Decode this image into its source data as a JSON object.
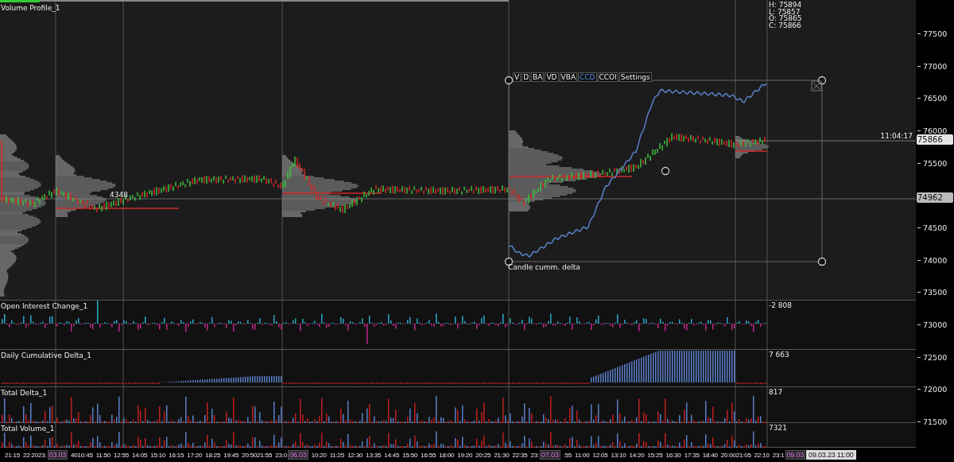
{
  "main": {
    "title": "Volume Profile_1",
    "ohlc": [
      "H: 75894",
      "L: 75857",
      "O: 75865",
      "C: 75866"
    ],
    "toolbar": [
      {
        "label": "V",
        "selected": false
      },
      {
        "label": "D",
        "selected": false
      },
      {
        "label": "BA",
        "selected": false
      },
      {
        "label": "VD",
        "selected": false
      },
      {
        "label": "VBA",
        "selected": false
      },
      {
        "label": "CCD",
        "selected": true
      },
      {
        "label": "CCOI",
        "selected": false
      },
      {
        "label": "Settings",
        "selected": false
      }
    ],
    "indicator_label": "Candle cumm. delta",
    "profile_label": "4348",
    "countdown": "11:04:17"
  },
  "subpanels": [
    {
      "kind": "oi",
      "title": "Open Interest Change_1",
      "value": "-2 808"
    },
    {
      "kind": "cumdelta",
      "title": "Daily Cumulative Delta_1",
      "value": "7 663"
    },
    {
      "kind": "delta",
      "title": "Total Delta_1",
      "value": "817"
    },
    {
      "kind": "volume",
      "title": "Total Volume_1",
      "value": "7321"
    }
  ],
  "price_axis": {
    "ticks": [
      "77500",
      "77000",
      "76500",
      "76000",
      "75500",
      "74500",
      "74000",
      "73500",
      "73000",
      "72500",
      "72000",
      "71500"
    ],
    "markers": [
      {
        "value": "75866",
        "kind": "last"
      },
      {
        "value": "74962",
        "kind": "cursor"
      }
    ]
  },
  "time_axis": [
    {
      "text": "21:15",
      "kind": "time"
    },
    {
      "text": "22:2023:",
      "kind": "time"
    },
    {
      "text": "03.03",
      "kind": "date"
    },
    {
      "text": "4010:45",
      "kind": "time"
    },
    {
      "text": "11:50",
      "kind": "time"
    },
    {
      "text": "12:55",
      "kind": "time"
    },
    {
      "text": "14:05",
      "kind": "time"
    },
    {
      "text": "15:10",
      "kind": "time"
    },
    {
      "text": "16:15",
      "kind": "time"
    },
    {
      "text": "17:20",
      "kind": "time"
    },
    {
      "text": "18:25",
      "kind": "time"
    },
    {
      "text": "19:45",
      "kind": "time"
    },
    {
      "text": "20:5021:55",
      "kind": "time"
    },
    {
      "text": "23:0",
      "kind": "time"
    },
    {
      "text": "06.03",
      "kind": "date"
    },
    {
      "text": "10:20",
      "kind": "time"
    },
    {
      "text": "11:25",
      "kind": "time"
    },
    {
      "text": "12:30",
      "kind": "time"
    },
    {
      "text": "13:35",
      "kind": "time"
    },
    {
      "text": "14:45",
      "kind": "time"
    },
    {
      "text": "15:50",
      "kind": "time"
    },
    {
      "text": "16:55",
      "kind": "time"
    },
    {
      "text": "18:00",
      "kind": "time"
    },
    {
      "text": "19:20",
      "kind": "time"
    },
    {
      "text": "20:25",
      "kind": "time"
    },
    {
      "text": "21:30",
      "kind": "time"
    },
    {
      "text": "22:35",
      "kind": "time"
    },
    {
      "text": "23:",
      "kind": "time"
    },
    {
      "text": "07.03",
      "kind": "date"
    },
    {
      "text": ":55",
      "kind": "time"
    },
    {
      "text": "11:00",
      "kind": "time"
    },
    {
      "text": "12:05",
      "kind": "time"
    },
    {
      "text": "13:10",
      "kind": "time"
    },
    {
      "text": "14:20",
      "kind": "time"
    },
    {
      "text": "15:25",
      "kind": "time"
    },
    {
      "text": "16:30",
      "kind": "time"
    },
    {
      "text": "17:35",
      "kind": "time"
    },
    {
      "text": "18:40",
      "kind": "time"
    },
    {
      "text": "20:0021:05",
      "kind": "time"
    },
    {
      "text": "22:10",
      "kind": "time"
    },
    {
      "text": "23:1",
      "kind": "time"
    },
    {
      "text": "09.03",
      "kind": "date"
    },
    {
      "text": "09.03.23 11:00",
      "kind": "cursor"
    }
  ]
}
